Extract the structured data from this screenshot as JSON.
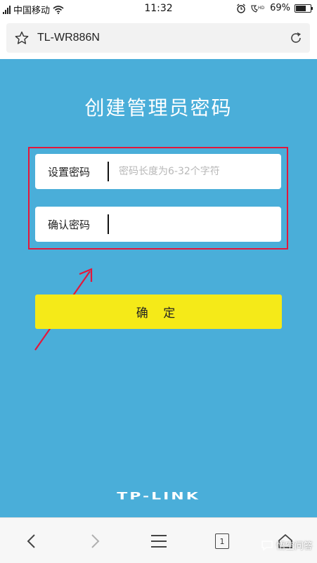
{
  "status_bar": {
    "carrier": "中国移动",
    "time": "11:32",
    "battery": "69%",
    "battery_level": 0.69,
    "icons": [
      "signal-icon",
      "wifi-icon",
      "alarm-icon",
      "volte-icon",
      "battery-icon"
    ]
  },
  "browser": {
    "url": "TL-WR886N",
    "icons": [
      "star-icon",
      "reload-icon"
    ]
  },
  "page": {
    "title": "创建管理员密码",
    "set_password_label": "设置密码",
    "set_password_placeholder": "密码长度为6-32个字符",
    "confirm_password_label": "确认密码",
    "confirm_button": "确 定",
    "brand_logo": "TP-LINK"
  },
  "bottom_nav": {
    "tab_count": "1",
    "icons": [
      "back-icon",
      "forward-icon",
      "menu-icon",
      "tabs-icon",
      "home-icon"
    ]
  },
  "watermark": "悟空问答",
  "colors": {
    "background": "#4aaed9",
    "button": "#f5ea18",
    "highlight": "#e3173b"
  }
}
